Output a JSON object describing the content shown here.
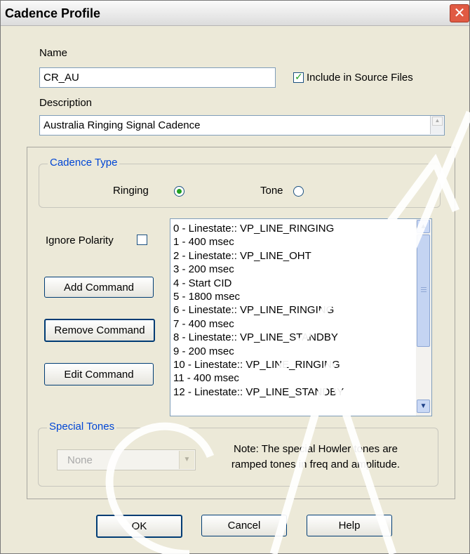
{
  "window": {
    "title": "Cadence Profile",
    "close_glyph": "✕"
  },
  "name": {
    "label": "Name",
    "value": "CR_AU"
  },
  "include_source": {
    "label": "Include in Source Files",
    "checked": true
  },
  "description": {
    "label": "Description",
    "value": "Australia Ringing Signal Cadence"
  },
  "cadence_type": {
    "legend": "Cadence Type",
    "ringing_label": "Ringing",
    "tone_label": "Tone",
    "selected": "Ringing"
  },
  "ignore_polarity": {
    "label": "Ignore Polarity",
    "checked": false
  },
  "buttons": {
    "add": "Add Command",
    "remove": "Remove Command",
    "edit": "Edit Command",
    "ok": "OK",
    "cancel": "Cancel",
    "help": "Help"
  },
  "commands": [
    "0 - Linestate:: VP_LINE_RINGING",
    "1 - 400 msec",
    "2 - Linestate:: VP_LINE_OHT",
    "3 - 200 msec",
    "4 - Start CID",
    "5 - 1800 msec",
    "6 - Linestate:: VP_LINE_RINGING",
    "7 - 400 msec",
    "8 - Linestate:: VP_LINE_STANDBY",
    "9 - 200 msec",
    "10 - Linestate:: VP_LINE_RINGING",
    "11 - 400 msec",
    "12 - Linestate:: VP_LINE_STANDBY"
  ],
  "special_tones": {
    "legend": "Special Tones",
    "selected": "None",
    "note_line1": "Note: The special Howler tones are",
    "note_line2": "ramped tones in freq and amplitude."
  },
  "icons": {
    "scroll_up": "▲",
    "scroll_down": "▼",
    "dropdown": "▼"
  },
  "colors": {
    "accent": "#0046d5",
    "check": "#21a121",
    "close": "#e05a43"
  }
}
